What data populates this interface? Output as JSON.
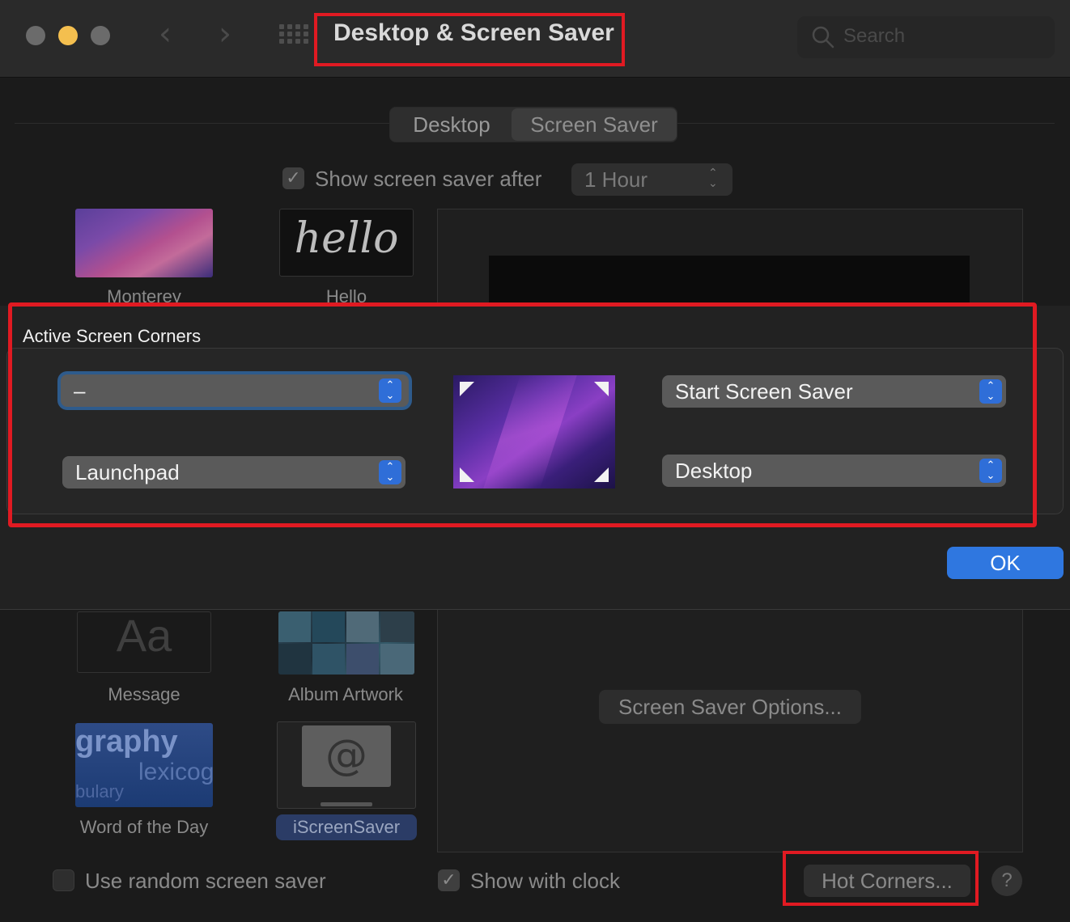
{
  "window": {
    "title": "Desktop & Screen Saver",
    "search_placeholder": "Search"
  },
  "tabs": [
    {
      "label": "Desktop",
      "selected": false
    },
    {
      "label": "Screen Saver",
      "selected": true
    }
  ],
  "screen_saver": {
    "show_after_label": "Show screen saver after",
    "show_after_checked": true,
    "delay_value": "1 Hour",
    "savers": [
      {
        "name": "Monterey"
      },
      {
        "name": "Hello",
        "thumb_text": "hello"
      },
      {
        "name": "Message",
        "thumb_text": "Aa"
      },
      {
        "name": "Album Artwork"
      },
      {
        "name": "Word of the Day",
        "thumb_text_1": "graphy",
        "thumb_text_2": "lexicog",
        "thumb_text_3": "bulary"
      },
      {
        "name": "iScreenSaver",
        "selected": true
      }
    ],
    "options_button": "Screen Saver Options...",
    "random_label": "Use random screen saver",
    "random_checked": false,
    "clock_label": "Show with clock",
    "clock_checked": true,
    "hot_corners_button": "Hot Corners...",
    "help_button": "?"
  },
  "hot_corners_sheet": {
    "title": "Active Screen Corners",
    "top_left": "–",
    "bottom_left": "Launchpad",
    "top_right": "Start Screen Saver",
    "bottom_right": "Desktop",
    "ok_button": "OK"
  },
  "colors": {
    "accent": "#2f77e0",
    "highlight_box": "#e01a22",
    "traffic_close": "#6b6b6b",
    "traffic_minimize": "#f4bf4f",
    "traffic_zoom": "#6b6b6b"
  },
  "icons": {
    "search": "search-icon",
    "back": "chevron-left-icon",
    "forward": "chevron-right-icon",
    "all_prefs": "grid-icon",
    "popup": "chevron-updown-icon",
    "checkmark": "checkmark-icon"
  }
}
